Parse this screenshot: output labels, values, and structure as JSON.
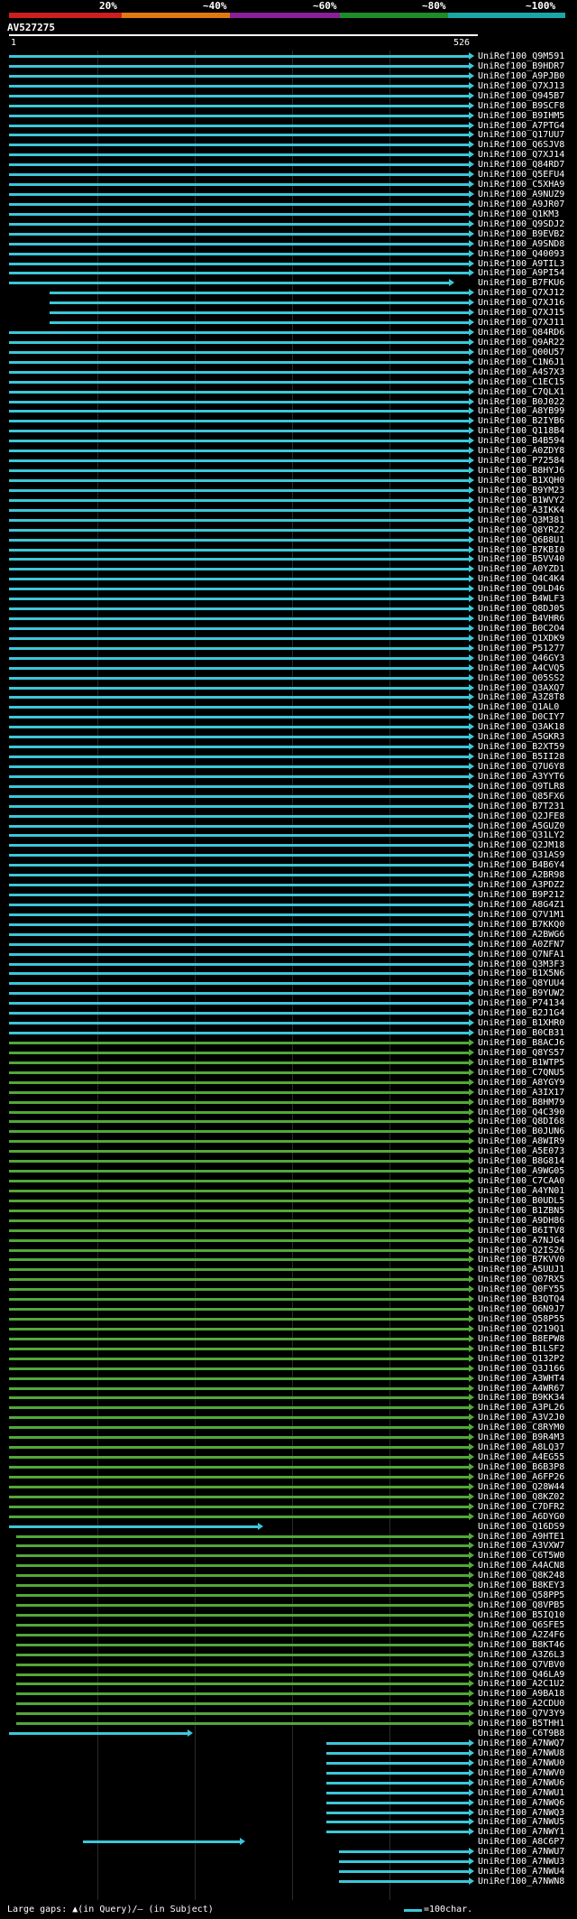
{
  "scale": {
    "labels": [
      "20%",
      "~40%",
      "~60%",
      "~80%",
      "~100%"
    ],
    "colors": [
      "#cc1f1f",
      "#e07a10",
      "#8a1f9a",
      "#1f8c2a",
      "#1aa6a6"
    ]
  },
  "query": {
    "id": "AV527275",
    "start": "1",
    "end": "526"
  },
  "colors": {
    "cyan": "#3cc7d8",
    "green": "#52a838",
    "grid": "#2a2a2a"
  },
  "hits": [
    "UniRef100_Q9M591",
    "UniRef100_B9HDR7",
    "UniRef100_A9PJB0",
    "UniRef100_Q7XJ13",
    "UniRef100_Q945B7",
    "UniRef100_B9SCF8",
    "UniRef100_B9IHM5",
    "UniRef100_A7PTG4",
    "UniRef100_Q17UU7",
    "UniRef100_Q6SJV8",
    "UniRef100_Q7XJ14",
    "UniRef100_Q84RD7",
    "UniRef100_Q5EFU4",
    "UniRef100_C5XHA9",
    "UniRef100_A9NUZ9",
    "UniRef100_A9JR07",
    "UniRef100_Q1KM3",
    "UniRef100_Q9SDJ2",
    "UniRef100_B9EVB2",
    "UniRef100_A9SND8",
    "UniRef100_Q40093",
    "UniRef100_A9TIL3",
    "UniRef100_A9PI54",
    "UniRef100_B7FKU6",
    "UniRef100_Q7XJ12",
    "UniRef100_Q7XJ16",
    "UniRef100_Q7XJ15",
    "UniRef100_Q7XJ11",
    "UniRef100_Q84RD6",
    "UniRef100_Q9AR22",
    "UniRef100_Q00U57",
    "UniRef100_C1N6J1",
    "UniRef100_A4S7X3",
    "UniRef100_C1EC15",
    "UniRef100_C7QLX1",
    "UniRef100_B0J022",
    "UniRef100_A8YB99",
    "UniRef100_B2IYB6",
    "UniRef100_Q118B4",
    "UniRef100_B4B594",
    "UniRef100_A0ZDY8",
    "UniRef100_P72584",
    "UniRef100_B8HYJ6",
    "UniRef100_B1XQH0",
    "UniRef100_B9YM23",
    "UniRef100_B1WVY2",
    "UniRef100_A3IKK4",
    "UniRef100_Q3M381",
    "UniRef100_Q8YR22",
    "UniRef100_Q6B8U1",
    "UniRef100_B7KBI0",
    "UniRef100_B5VV40",
    "UniRef100_A0YZD1",
    "UniRef100_Q4C4K4",
    "UniRef100_Q9LD46",
    "UniRef100_B4WLF3",
    "UniRef100_Q8DJ05",
    "UniRef100_B4VHR6",
    "UniRef100_B0C2O4",
    "UniRef100_Q1XDK9",
    "UniRef100_P51277",
    "UniRef100_Q46GY3",
    "UniRef100_A4CVQ5",
    "UniRef100_Q05SS2",
    "UniRef100_Q3AXQ7",
    "UniRef100_A3Z8T8",
    "UniRef100_Q1AL0",
    "UniRef100_D0CIY7",
    "UniRef100_Q3AK18",
    "UniRef100_A5GKR3",
    "UniRef100_B2XT59",
    "UniRef100_B5II28",
    "UniRef100_Q7U6Y8",
    "UniRef100_A3YYT6",
    "UniRef100_Q9TLR8",
    "UniRef100_Q85FX6",
    "UniRef100_B7T231",
    "UniRef100_Q2JFE8",
    "UniRef100_A5GUZ0",
    "UniRef100_Q31LY2",
    "UniRef100_Q2JM18",
    "UniRef100_Q31AS9",
    "UniRef100_B4B6Y4",
    "UniRef100_A2BR98",
    "UniRef100_A3PDZ2",
    "UniRef100_B9P212",
    "UniRef100_A8G4Z1",
    "UniRef100_Q7V1M1",
    "UniRef100_B7KKQ0",
    "UniRef100_A2BWG6",
    "UniRef100_A0ZFN7",
    "UniRef100_Q7NFA1",
    "UniRef100_Q3M3F3",
    "UniRef100_B1X5N6",
    "UniRef100_Q8YUU4",
    "UniRef100_B9YUW2",
    "UniRef100_P74134",
    "UniRef100_B2J1G4",
    "UniRef100_B1XHR0",
    "UniRef100_B0CB31",
    "UniRef100_B8ACJ6",
    "UniRef100_Q8YS57",
    "UniRef100_B1WTP5",
    "UniRef100_C7QNU5",
    "UniRef100_A8YGY9",
    "UniRef100_A3IX17",
    "UniRef100_B8HM79",
    "UniRef100_Q4C390",
    "UniRef100_Q8DI68",
    "UniRef100_B0JUN6",
    "UniRef100_A8WIR9",
    "UniRef100_A5E073",
    "UniRef100_B8G814",
    "UniRef100_A9WG05",
    "UniRef100_C7CAA0",
    "UniRef100_A4YN01",
    "UniRef100_B0UDL5",
    "UniRef100_B1ZBN5",
    "UniRef100_A9DH86",
    "UniRef100_B6ITV8",
    "UniRef100_A7NJG4",
    "UniRef100_Q2IS26",
    "UniRef100_B7KVV0",
    "UniRef100_A5UUJ1",
    "UniRef100_Q07RX5",
    "UniRef100_Q0FY55",
    "UniRef100_B3QTQ4",
    "UniRef100_Q6N9J7",
    "UniRef100_Q58P55",
    "UniRef100_Q219Q1",
    "UniRef100_B8EPW8",
    "UniRef100_B1LSF2",
    "UniRef100_Q132P2",
    "UniRef100_Q3J166",
    "UniRef100_A3WHT4",
    "UniRef100_A4WR67",
    "UniRef100_B9KK34",
    "UniRef100_A3PL26",
    "UniRef100_A3V2J0",
    "UniRef100_C8RYM0",
    "UniRef100_B9R4M3",
    "UniRef100_A8LQ37",
    "UniRef100_A4EG55",
    "UniRef100_B6B3P8",
    "UniRef100_A6FP26",
    "UniRef100_Q28W44",
    "UniRef100_Q8KZ02",
    "UniRef100_C7DFR2",
    "UniRef100_A6DYG0",
    "UniRef100_Q16DS9",
    "UniRef100_A9HTE1",
    "UniRef100_A3VXW7",
    "UniRef100_C6T5W0",
    "UniRef100_A4ACN8",
    "UniRef100_Q8K248",
    "UniRef100_B8KEY3",
    "UniRef100_Q58PP5",
    "UniRef100_Q8VPB5",
    "UniRef100_B5IQ10",
    "UniRef100_Q6SFE5",
    "UniRef100_A2Z4F6",
    "UniRef100_B8KT46",
    "UniRef100_A3Z6L3",
    "UniRef100_Q7VBV0",
    "UniRef100_Q46LA9",
    "UniRef100_A2C1U2",
    "UniRef100_A9BA18",
    "UniRef100_A2CDU0",
    "UniRef100_Q7V3Y9",
    "UniRef100_B5THH1",
    "UniRef100_C6T9B8",
    "UniRef100_A7NWQ7",
    "UniRef100_A7NWU8",
    "UniRef100_A7NWU0",
    "UniRef100_A7NWV0",
    "UniRef100_A7NWU6",
    "UniRef100_A7NWU1",
    "UniRef100_A7NWQ6",
    "UniRef100_A7NWQ3",
    "UniRef100_A7NWU5",
    "UniRef100_A7NWY1",
    "UniRef100_A8C6P7",
    "UniRef100_A7NWU7",
    "UniRef100_A7NWU3",
    "UniRef100_A7NWU4",
    "UniRef100_A7NWN8"
  ],
  "legend": {
    "gaps_label": "Large gaps: ▲(in Query)/– (in Subject)",
    "scale_label": "=100char."
  }
}
